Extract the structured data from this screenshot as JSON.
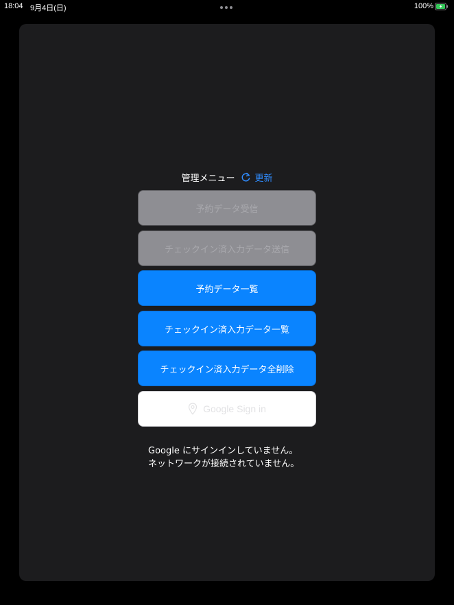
{
  "status_bar": {
    "time": "18:04",
    "date": "9月4日(日)",
    "battery_percent": "100%"
  },
  "header": {
    "title": "管理メニュー",
    "refresh_label": "更新",
    "accent_color": "#2f8cff"
  },
  "buttons": [
    {
      "label": "予約データ受信",
      "state": "disabled"
    },
    {
      "label": "チェックイン済入力データ送信",
      "state": "disabled"
    },
    {
      "label": "予約データ一覧",
      "state": "enabled"
    },
    {
      "label": "チェックイン済入力データ一覧",
      "state": "enabled"
    },
    {
      "label": "チェックイン済入力データ全削除",
      "state": "enabled"
    },
    {
      "label": "Google Sign in",
      "state": "enabled",
      "icon": "location-pin-icon"
    }
  ],
  "status_messages": [
    "Google にサインインしていません。",
    "ネットワークが接続されていません。"
  ]
}
